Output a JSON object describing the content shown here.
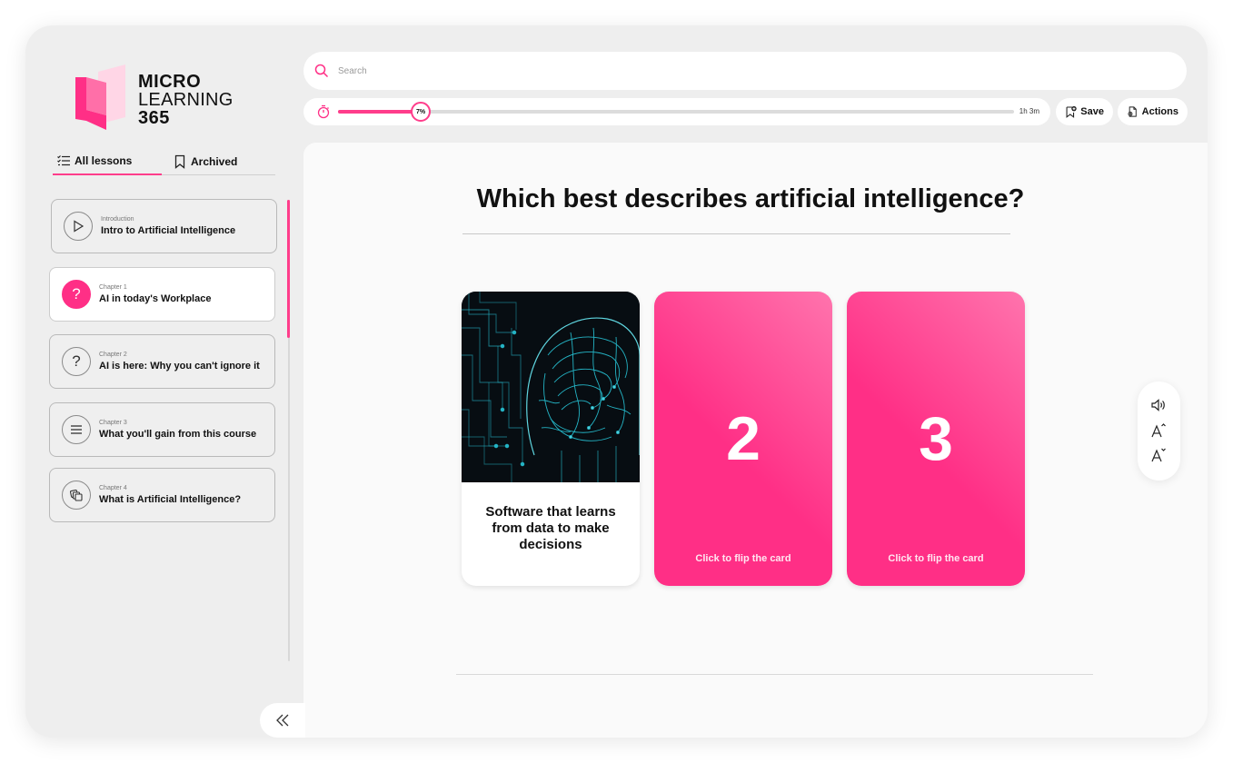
{
  "brand": {
    "line1": "MICRO",
    "line2": "LEARNING",
    "line3": "365",
    "accent_color": "#ff2f86"
  },
  "tabs": {
    "all_lessons": "All lessons",
    "archived": "Archived",
    "active": "all_lessons"
  },
  "lessons": [
    {
      "kicker": "Introduction",
      "title": "Intro to Artificial Intelligence",
      "icon": "play-icon",
      "active": false
    },
    {
      "kicker": "Chapter 1",
      "title": "AI in today's Workplace",
      "icon": "question-icon",
      "active": true
    },
    {
      "kicker": "Chapter 2",
      "title": "AI is here: Why you can't ignore it",
      "icon": "question-icon",
      "active": false
    },
    {
      "kicker": "Chapter 3",
      "title": "What you'll gain from this course",
      "icon": "list-icon",
      "active": false
    },
    {
      "kicker": "Chapter 4",
      "title": "What is Artificial Intelligence?",
      "icon": "layers-icon",
      "active": false
    }
  ],
  "search": {
    "placeholder": "Search",
    "value": ""
  },
  "progress": {
    "percent": 7,
    "percent_label": "7%",
    "duration": "1h 3m"
  },
  "toolbar": {
    "save_label": "Save",
    "actions_label": "Actions"
  },
  "question": {
    "text": "Which best describes artificial intelligence?"
  },
  "cards": [
    {
      "type": "revealed",
      "answer": "Software that learns from data to make decisions",
      "image": "circuit-brain-image"
    },
    {
      "type": "hidden",
      "number": "2",
      "hint": "Click to flip the card"
    },
    {
      "type": "hidden",
      "number": "3",
      "hint": "Click to flip the card"
    }
  ],
  "accessibility": {
    "icons": [
      "speaker-icon",
      "font-increase-icon",
      "font-decrease-icon"
    ]
  }
}
